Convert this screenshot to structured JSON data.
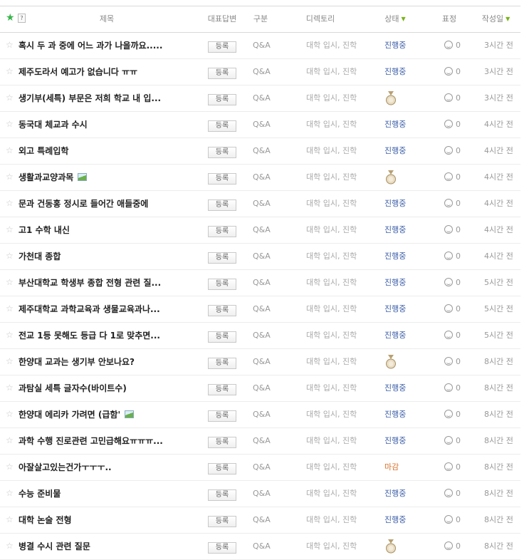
{
  "header": {
    "star_glyph": "★",
    "help_label": "?",
    "title": "제목",
    "answer": "대표답변",
    "type": "구분",
    "directory": "디렉토리",
    "status": "상태",
    "face": "표정",
    "date": "작성일",
    "caret": "▼"
  },
  "register_label": "등록",
  "rows": [
    {
      "title": "혹시 두 과 중에 어느 과가 나을까요.....",
      "type": "Q&A",
      "dir": "대학 입시, 진학",
      "status": "진행중",
      "status_kind": "progress",
      "face": "0",
      "date": "3시간 전",
      "has_image": false
    },
    {
      "title": "제주도라서 예고가 없습니다 ㅠㅠ",
      "type": "Q&A",
      "dir": "대학 입시, 진학",
      "status": "진행중",
      "status_kind": "progress",
      "face": "0",
      "date": "3시간 전",
      "has_image": false
    },
    {
      "title": "생기부(세특) 부문은 저희 학교 내 입...",
      "type": "Q&A",
      "dir": "대학 입시, 진학",
      "status": "",
      "status_kind": "medal",
      "face": "0",
      "date": "3시간 전",
      "has_image": false
    },
    {
      "title": "동국대 체교과 수시",
      "type": "Q&A",
      "dir": "대학 입시, 진학",
      "status": "진행중",
      "status_kind": "progress",
      "face": "0",
      "date": "4시간 전",
      "has_image": false
    },
    {
      "title": "외고 특례입학",
      "type": "Q&A",
      "dir": "대학 입시, 진학",
      "status": "진행중",
      "status_kind": "progress",
      "face": "0",
      "date": "4시간 전",
      "has_image": false
    },
    {
      "title": "생활과교양과목",
      "type": "Q&A",
      "dir": "대학 입시, 진학",
      "status": "",
      "status_kind": "medal",
      "face": "0",
      "date": "4시간 전",
      "has_image": true
    },
    {
      "title": "문과 건동홍 정시로 들어간 애들중에",
      "type": "Q&A",
      "dir": "대학 입시, 진학",
      "status": "진행중",
      "status_kind": "progress",
      "face": "0",
      "date": "4시간 전",
      "has_image": false
    },
    {
      "title": "고1 수학 내신",
      "type": "Q&A",
      "dir": "대학 입시, 진학",
      "status": "진행중",
      "status_kind": "progress",
      "face": "0",
      "date": "4시간 전",
      "has_image": false
    },
    {
      "title": "가천대 종합",
      "type": "Q&A",
      "dir": "대학 입시, 진학",
      "status": "진행중",
      "status_kind": "progress",
      "face": "0",
      "date": "4시간 전",
      "has_image": false
    },
    {
      "title": "부산대학교 학생부 종합 전형 관련 질...",
      "type": "Q&A",
      "dir": "대학 입시, 진학",
      "status": "진행중",
      "status_kind": "progress",
      "face": "0",
      "date": "5시간 전",
      "has_image": false
    },
    {
      "title": "제주대학교 과학교육과 생물교육과나...",
      "type": "Q&A",
      "dir": "대학 입시, 진학",
      "status": "진행중",
      "status_kind": "progress",
      "face": "0",
      "date": "5시간 전",
      "has_image": false
    },
    {
      "title": "전교 1등 못해도 등급 다 1로 맞추면...",
      "type": "Q&A",
      "dir": "대학 입시, 진학",
      "status": "진행중",
      "status_kind": "progress",
      "face": "0",
      "date": "5시간 전",
      "has_image": false
    },
    {
      "title": "한양대 교과는 생기부 안보나요?",
      "type": "Q&A",
      "dir": "대학 입시, 진학",
      "status": "",
      "status_kind": "medal",
      "face": "0",
      "date": "8시간 전",
      "has_image": false
    },
    {
      "title": "과탐실 세특 글자수(바이트수)",
      "type": "Q&A",
      "dir": "대학 입시, 진학",
      "status": "진행중",
      "status_kind": "progress",
      "face": "0",
      "date": "8시간 전",
      "has_image": false
    },
    {
      "title": "한양대 에리카 가려면 (급함'",
      "type": "Q&A",
      "dir": "대학 입시, 진학",
      "status": "진행중",
      "status_kind": "progress",
      "face": "0",
      "date": "8시간 전",
      "has_image": true
    },
    {
      "title": "과학 수행 진로관련 고민급해요ㅠㅠㅠ...",
      "type": "Q&A",
      "dir": "대학 입시, 진학",
      "status": "진행중",
      "status_kind": "progress",
      "face": "0",
      "date": "8시간 전",
      "has_image": false
    },
    {
      "title": "아잘살고있는건가ㅜㅜㅜ..",
      "type": "Q&A",
      "dir": "대학 입시, 진학",
      "status": "마감",
      "status_kind": "closed",
      "face": "0",
      "date": "8시간 전",
      "has_image": false
    },
    {
      "title": "수능 준비물",
      "type": "Q&A",
      "dir": "대학 입시, 진학",
      "status": "진행중",
      "status_kind": "progress",
      "face": "0",
      "date": "8시간 전",
      "has_image": false
    },
    {
      "title": "대학 논술 전형",
      "type": "Q&A",
      "dir": "대학 입시, 진학",
      "status": "진행중",
      "status_kind": "progress",
      "face": "0",
      "date": "8시간 전",
      "has_image": false
    },
    {
      "title": "병결 수시 관련 질문",
      "type": "Q&A",
      "dir": "대학 입시, 진학",
      "status": "",
      "status_kind": "medal",
      "face": "0",
      "date": "8시간 전",
      "has_image": false
    }
  ],
  "colors": {
    "accent_green": "#39b54a",
    "status_progress": "#3d5fa8",
    "status_closed": "#d9712a"
  },
  "icons": {
    "row_star": "star-outline-icon",
    "medal": "medal-icon",
    "face": "smiley-icon",
    "image": "image-attachment-icon"
  }
}
